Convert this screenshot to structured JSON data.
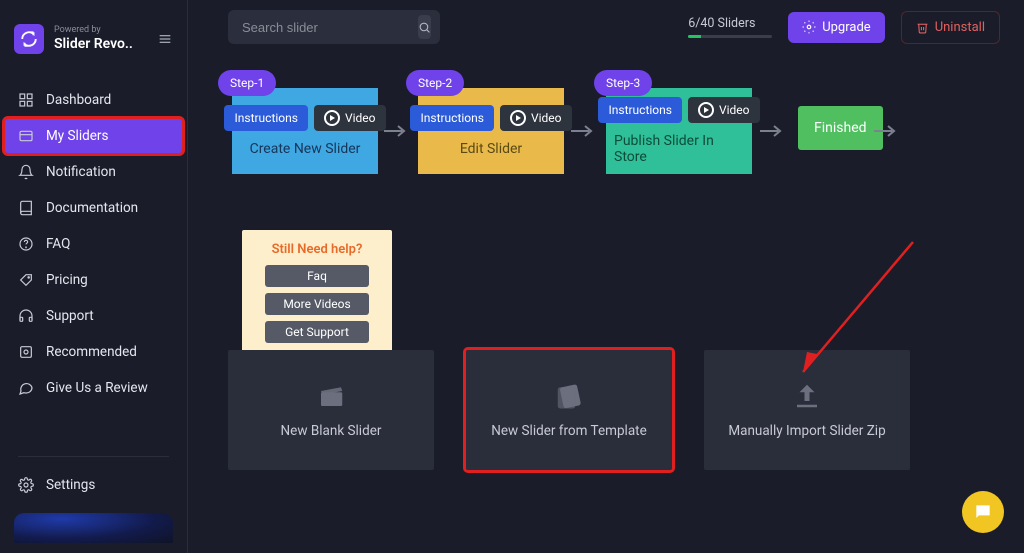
{
  "brand": {
    "powered": "Powered by",
    "name": "Slider Revo.."
  },
  "nav": {
    "dashboard": "Dashboard",
    "mySliders": "My Sliders",
    "notification": "Notification",
    "documentation": "Documentation",
    "faq": "FAQ",
    "pricing": "Pricing",
    "support": "Support",
    "recommended": "Recommended",
    "review": "Give Us a Review",
    "settings": "Settings"
  },
  "topbar": {
    "search_placeholder": "Search slider",
    "slider_count": "6/40 Sliders",
    "upgrade": "Upgrade",
    "uninstall": "Uninstall"
  },
  "steps": {
    "labels": {
      "s1": "Step-1",
      "s2": "Step-2",
      "s3": "Step-3"
    },
    "instructions": "Instructions",
    "video": "Video",
    "titles": {
      "s1": "Create New Slider",
      "s2": "Edit Slider",
      "s3": "Publish Slider In Store"
    },
    "finished": "Finished"
  },
  "help": {
    "title": "Still Need help?",
    "faq": "Faq",
    "more_videos": "More Videos",
    "get_support": "Get Support"
  },
  "cards": {
    "blank": "New Blank Slider",
    "template": "New Slider from Template",
    "import": "Manually Import Slider Zip"
  }
}
